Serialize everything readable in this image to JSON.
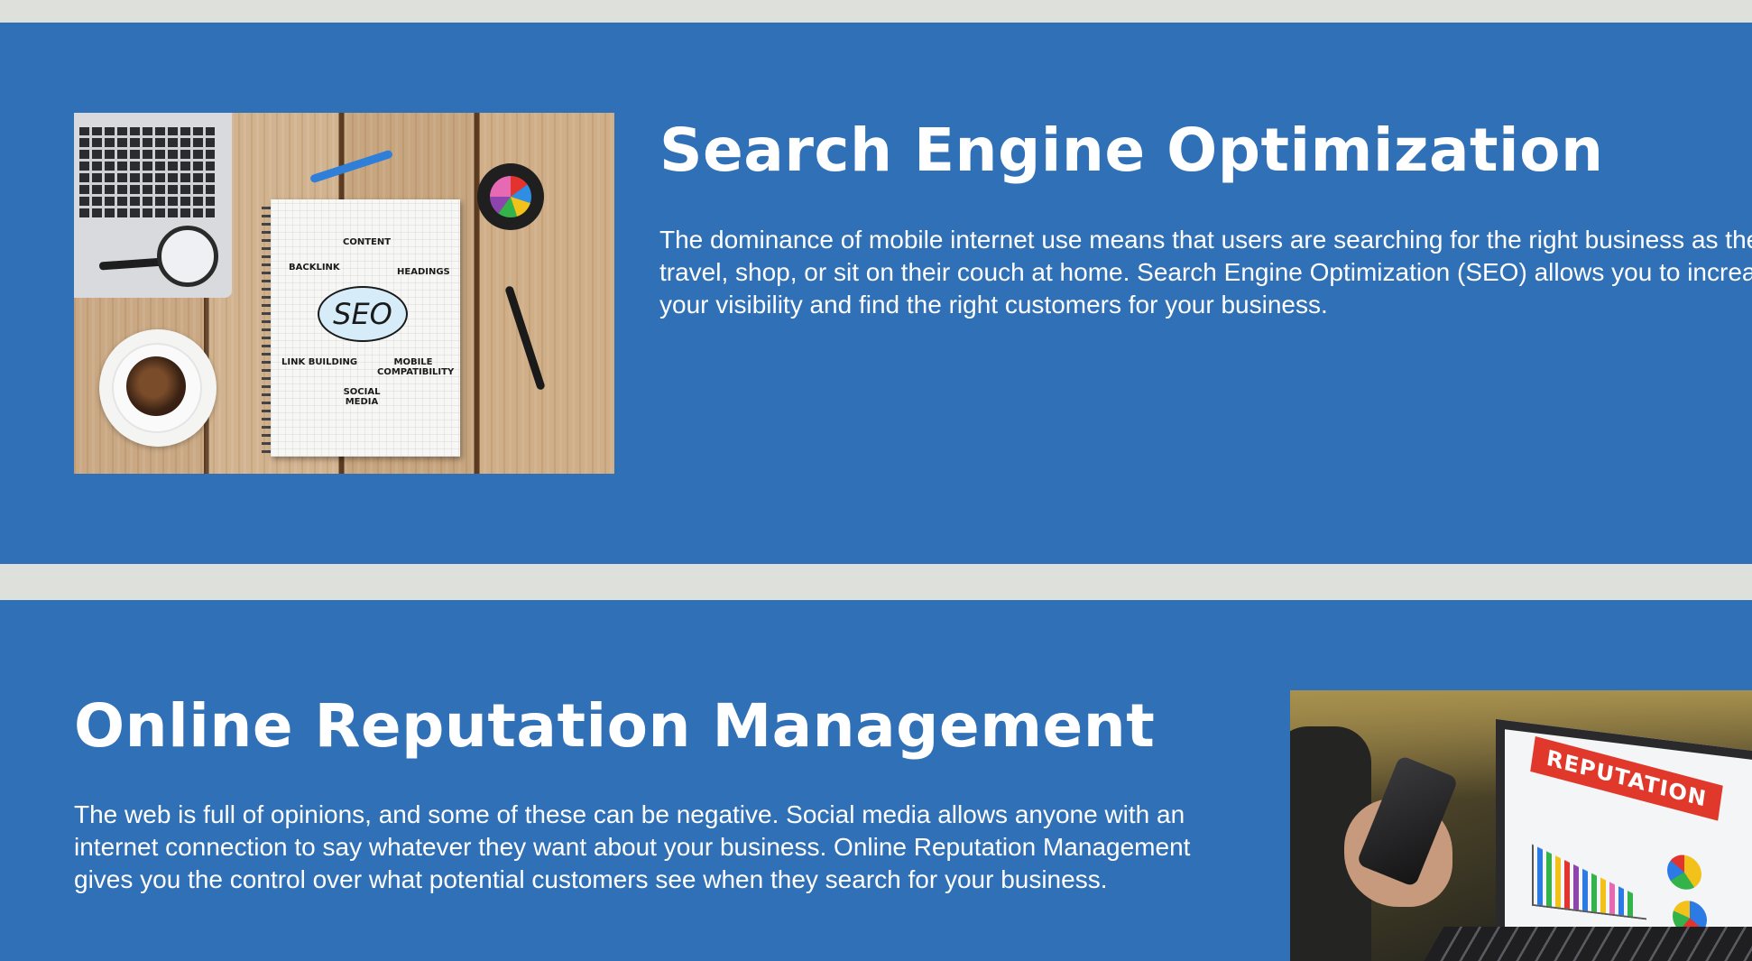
{
  "sections": {
    "seo": {
      "title": "Search Engine Optimization",
      "body": "The dominance of mobile internet use means that users are searching for the right business as they travel, shop, or sit on their couch at home. Search Engine Optimization (SEO) allows you to increase your visibility and find the right customers for your business.",
      "image": {
        "content_label": "CONTENT",
        "backlink_label": "BACKLINK",
        "headings_label": "HEADINGS",
        "seo_label": "SEO",
        "link_building_label": "LINK BUILDING",
        "mobile_label": "MOBILE COMPATIBILITY",
        "social_label": "SOCIAL MEDIA"
      }
    },
    "orm": {
      "title": "Online Reputation Management",
      "body": "The web is full of opinions, and some of these can be negative. Social media allows anyone with an internet connection to say whatever they want about your business. Online Reputation Management gives you the control over what potential customers see when they search for your business.",
      "image": {
        "banner_label": "REPUTATION"
      }
    }
  },
  "colors": {
    "page_background": "#dde0db",
    "section_background": "#3070b6",
    "text": "#ffffff",
    "reputation_banner": "#e0392c"
  }
}
